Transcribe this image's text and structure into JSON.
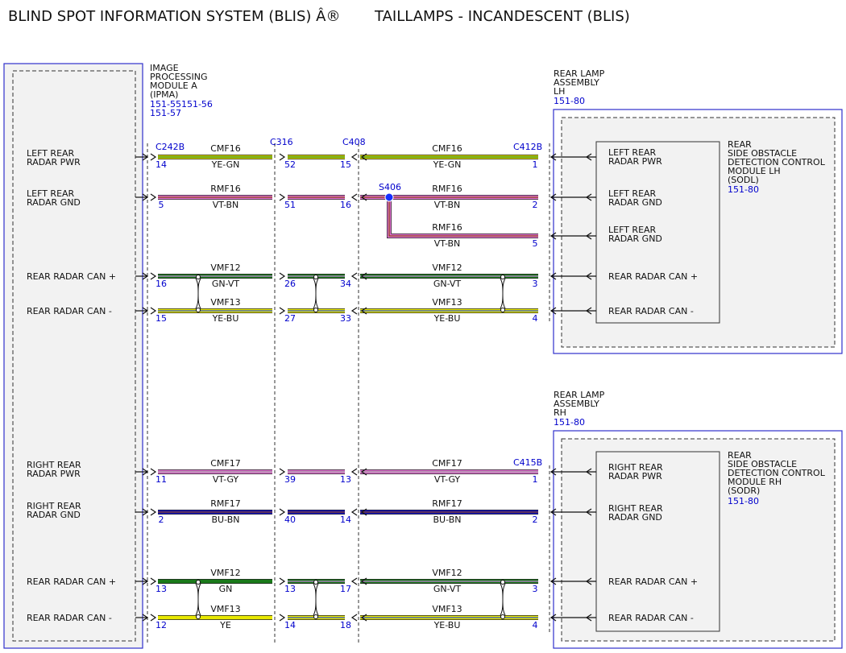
{
  "header": {
    "title_left": "BLIND SPOT INFORMATION SYSTEM (BLIS) Â®",
    "title_right": "TAILLAMPS - INCANDESCENT (BLIS)"
  },
  "ipma": {
    "name_lines": [
      "IMAGE",
      "PROCESSING",
      "MODULE A",
      "(IPMA)"
    ],
    "refs": [
      "151-55151-56",
      "151-57"
    ],
    "pins": [
      {
        "lines": [
          "LEFT REAR",
          "RADAR PWR"
        ]
      },
      {
        "lines": [
          "LEFT REAR",
          "RADAR GND"
        ]
      },
      {
        "lines": [
          "REAR RADAR CAN +"
        ]
      },
      {
        "lines": [
          "REAR RADAR CAN -"
        ]
      },
      {
        "lines": [
          "RIGHT REAR",
          "RADAR PWR"
        ]
      },
      {
        "lines": [
          "RIGHT REAR",
          "RADAR GND"
        ]
      },
      {
        "lines": [
          "REAR RADAR CAN +"
        ]
      },
      {
        "lines": [
          "REAR RADAR CAN -"
        ]
      }
    ]
  },
  "connectors": {
    "c242b": "C242B",
    "c316": "C316",
    "c408": "C408",
    "c412b": "C412B",
    "c415b": "C415B",
    "s406": "S406"
  },
  "lamp_lh": {
    "name_lines": [
      "REAR LAMP",
      "ASSEMBLY",
      "LH"
    ],
    "ref": "151-80",
    "module_lines": [
      "REAR",
      "SIDE OBSTACLE",
      "DETECTION CONTROL",
      "MODULE LH",
      "(SODL)"
    ],
    "module_ref": "151-80",
    "pins": [
      {
        "lines": [
          "LEFT REAR",
          "RADAR PWR"
        ]
      },
      {
        "lines": [
          "LEFT REAR",
          "RADAR GND"
        ]
      },
      {
        "lines": [
          "LEFT REAR",
          "RADAR GND"
        ]
      },
      {
        "lines": [
          "REAR RADAR CAN +"
        ]
      },
      {
        "lines": [
          "REAR RADAR CAN -"
        ]
      }
    ]
  },
  "lamp_rh": {
    "name_lines": [
      "REAR LAMP",
      "ASSEMBLY",
      "RH"
    ],
    "ref": "151-80",
    "module_lines": [
      "REAR",
      "SIDE OBSTACLE",
      "DETECTION CONTROL",
      "MODULE RH",
      "(SODR)"
    ],
    "module_ref": "151-80",
    "pins": [
      {
        "lines": [
          "RIGHT REAR",
          "RADAR PWR"
        ]
      },
      {
        "lines": [
          "RIGHT REAR",
          "RADAR GND"
        ]
      },
      {
        "lines": [
          "REAR RADAR CAN +"
        ]
      },
      {
        "lines": [
          "REAR RADAR CAN -"
        ]
      }
    ]
  },
  "wires": [
    {
      "circuit_left": "CMF16",
      "color_left": "YE-GN",
      "circuit_right": "CMF16",
      "color_right": "YE-GN",
      "pins": [
        "14",
        "52",
        "15",
        "1"
      ],
      "base": "#d6d600",
      "stripe": "#2e8b2e"
    },
    {
      "circuit_left": "RMF16",
      "color_left": "VT-BN",
      "circuit_right": "RMF16",
      "color_right": "VT-BN",
      "pins": [
        "5",
        "51",
        "16",
        "2"
      ],
      "base": "#e070d0",
      "stripe": "#8b4513"
    },
    {
      "circuit_right": "RMF16",
      "color_right": "VT-BN",
      "pins": [
        "5"
      ],
      "base": "#e070d0",
      "stripe": "#8b4513"
    },
    {
      "circuit_left": "VMF12",
      "color_left": "GN-VT",
      "circuit_right": "VMF12",
      "color_right": "GN-VT",
      "pins": [
        "16",
        "26",
        "34",
        "3"
      ],
      "base": "#1a7a1a",
      "stripe": "#c080d8"
    },
    {
      "circuit_left": "VMF13",
      "color_left": "YE-BU",
      "circuit_right": "VMF13",
      "color_right": "YE-BU",
      "pins": [
        "15",
        "27",
        "33",
        "4"
      ],
      "base": "#e8e800",
      "stripe": "#3050d0"
    },
    {
      "circuit_left": "CMF17",
      "color_left": "VT-GY",
      "circuit_right": "CMF17",
      "color_right": "VT-GY",
      "pins": [
        "11",
        "39",
        "13",
        "1"
      ],
      "base": "#e070d0",
      "stripe": "#a0a0a0"
    },
    {
      "circuit_left": "RMF17",
      "color_left": "BU-BN",
      "circuit_right": "RMF17",
      "color_right": "BU-BN",
      "pins": [
        "2",
        "40",
        "14",
        "2"
      ],
      "base": "#1010c0",
      "stripe": "#8b4513"
    },
    {
      "circuit_left": "VMF12",
      "color_left": "GN",
      "circuit_right": "VMF12",
      "color_right": "GN-VT",
      "pins": [
        "13",
        "13",
        "17",
        "3"
      ],
      "base": "#1a7a1a",
      "stripe": "#c080d8"
    },
    {
      "circuit_left": "VMF13",
      "color_left": "YE",
      "circuit_right": "VMF13",
      "color_right": "YE-BU",
      "pins": [
        "12",
        "14",
        "18",
        "4"
      ],
      "base": "#e8e800",
      "stripe": "#3050d0"
    }
  ]
}
